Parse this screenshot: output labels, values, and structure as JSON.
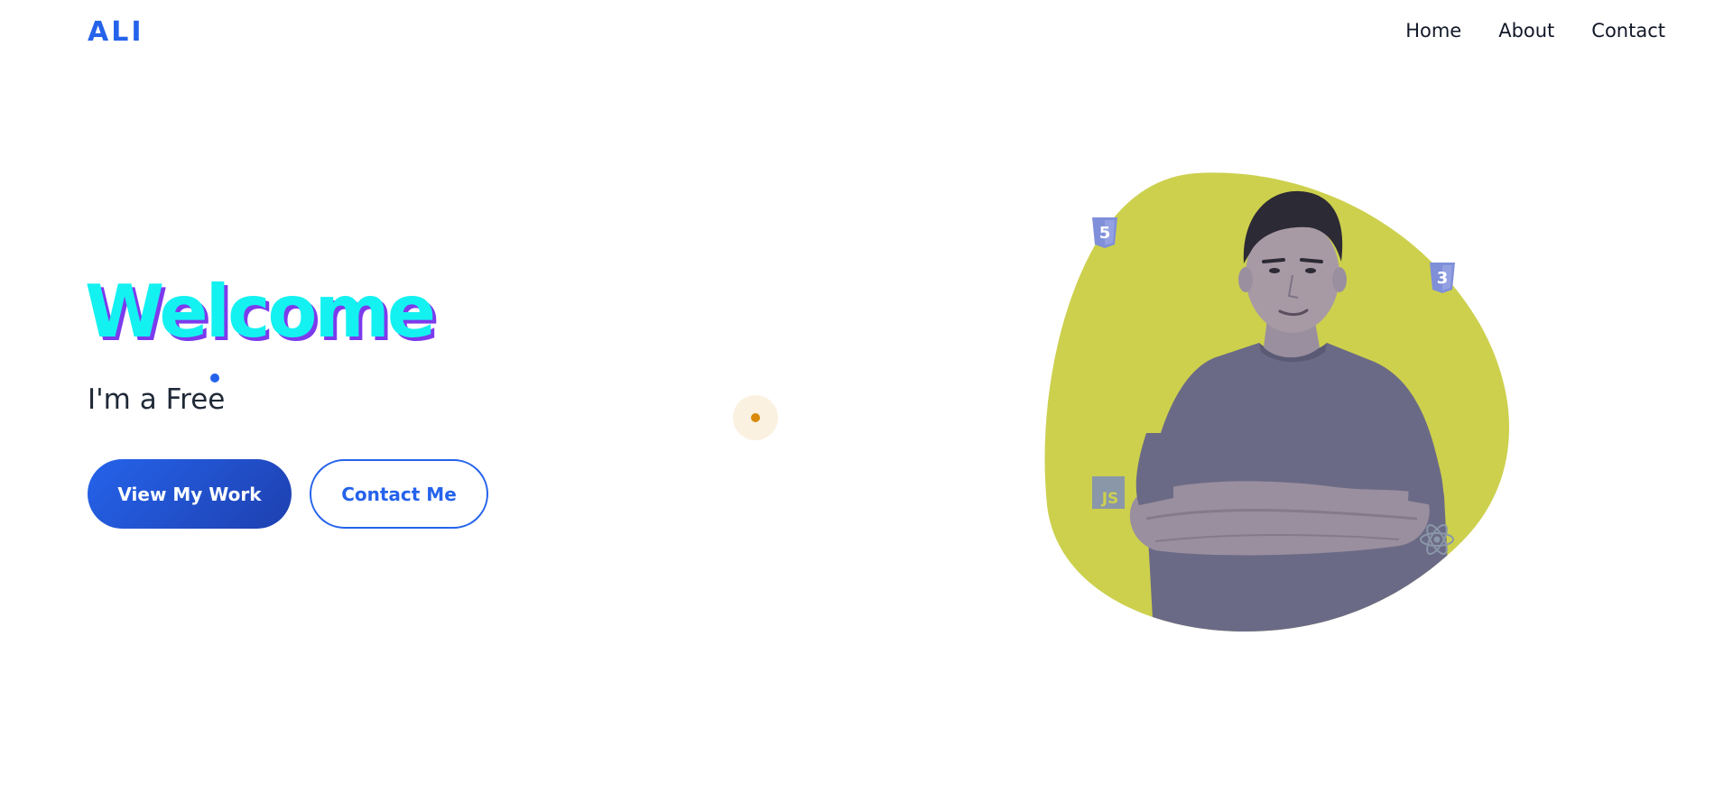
{
  "header": {
    "logo": "ALI",
    "nav": [
      {
        "label": "Home"
      },
      {
        "label": "About"
      },
      {
        "label": "Contact"
      }
    ]
  },
  "hero": {
    "heading": "Welcome",
    "tagline": "I'm a Free",
    "buttons": {
      "primary": "View My Work",
      "secondary": "Contact Me"
    },
    "tech_icons": {
      "html": "5",
      "css": "3",
      "js": "JS"
    }
  },
  "colors": {
    "accent": "#2563eb",
    "heading": "#14f1f1",
    "heading_shadow": "#7c3aed",
    "blob": "#cdd04d"
  },
  "icons": [
    "html5-icon",
    "css3-icon",
    "javascript-icon",
    "react-icon",
    "scroll-indicator"
  ]
}
